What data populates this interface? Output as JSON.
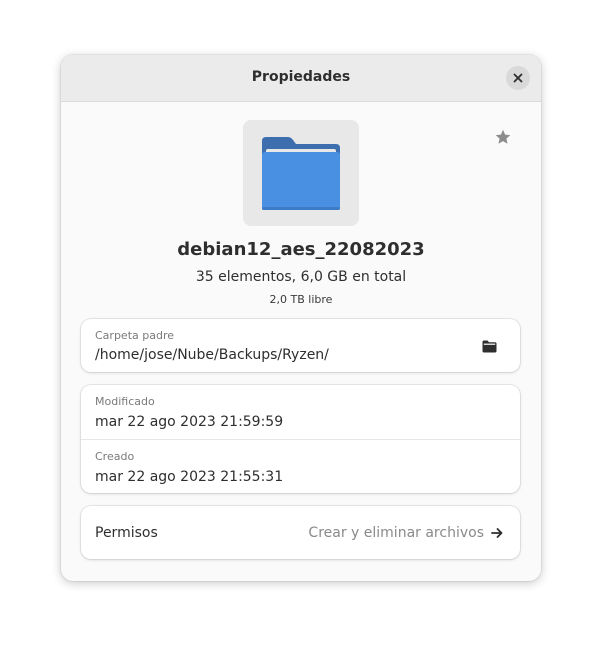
{
  "header": {
    "title": "Propiedades",
    "close_icon": "close-icon"
  },
  "star_icon": "star-icon",
  "file": {
    "icon": "folder-icon",
    "name": "debian12_aes_22082023",
    "summary": "35 elementos, 6,0 GB en total",
    "free_space": "2,0 TB libre"
  },
  "parent_folder": {
    "label": "Carpeta padre",
    "path": "/home/jose/Nube/Backups/Ryzen/",
    "open_icon": "folder-open-icon"
  },
  "dates": {
    "modified_label": "Modificado",
    "modified_value": "mar 22 ago 2023 21:59:59",
    "created_label": "Creado",
    "created_value": "mar 22 ago 2023 21:55:31"
  },
  "permissions": {
    "label": "Permisos",
    "value": "Crear y eliminar archivos",
    "arrow_icon": "arrow-right-icon"
  },
  "colors": {
    "folder_front": "#4a90e2",
    "folder_back": "#3d6fae",
    "accent_text": "#2e2e2e",
    "muted_text": "#7a7a7a"
  }
}
